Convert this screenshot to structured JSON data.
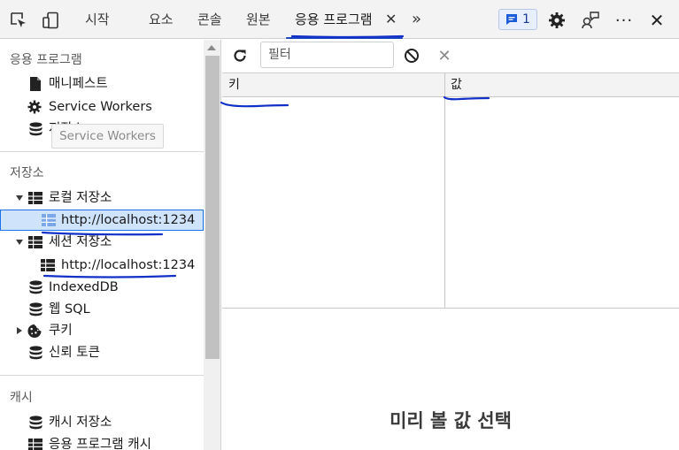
{
  "tabbar": {
    "tabs": [
      {
        "label": "시작"
      },
      {
        "label": "요소"
      },
      {
        "label": "콘솔"
      },
      {
        "label": "원본"
      },
      {
        "label": "응용 프로그램"
      }
    ],
    "message_count": "1",
    "accent": "#1a44c0"
  },
  "sidebar": {
    "app_section": "응용 프로그램",
    "app_items": [
      "매니페스트",
      "Service Workers",
      "저장소"
    ],
    "tooltip": "Service Workers",
    "storage_section": "저장소",
    "local_storage": "로컬 저장소",
    "local_origin": "http://localhost:1234",
    "session_storage": "세션 저장소",
    "session_origin": "http://localhost:1234",
    "indexeddb": "IndexedDB",
    "websql": "웹 SQL",
    "cookies": "쿠키",
    "trust_tokens": "신뢰 토큰",
    "cache_section": "캐시",
    "cache_storage": "캐시 저장소",
    "app_cache": "응용 프로그램 캐시"
  },
  "toolbar": {
    "filter_placeholder": "필터"
  },
  "grid": {
    "columns": [
      "키",
      "값"
    ]
  },
  "preview": {
    "text": "미리 볼 값 선택"
  },
  "annotation": {
    "color": "#1030c8"
  }
}
